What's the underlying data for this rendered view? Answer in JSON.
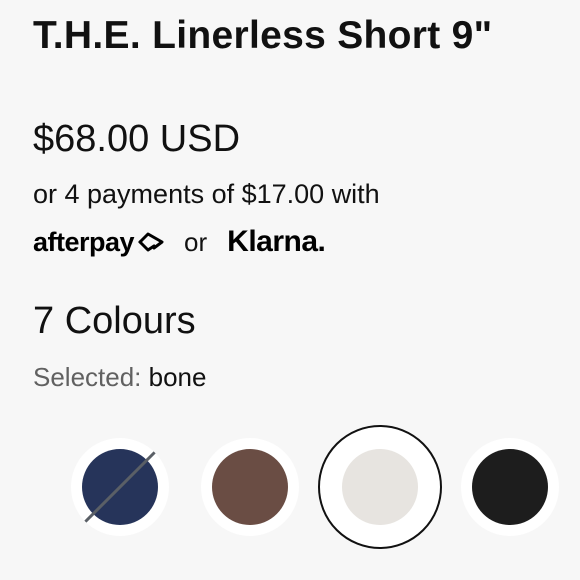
{
  "product": {
    "title": "T.H.E. Linerless Short 9\""
  },
  "pricing": {
    "price": "$68.00 USD",
    "installments_text": "or 4 payments of $17.00 with",
    "afterpay_label": "afterpay",
    "or_text": "or",
    "klarna_label": "Klarna."
  },
  "colours": {
    "count_text": "7 Colours",
    "selected_label": "Selected:",
    "selected_value": "bone",
    "swatches": [
      {
        "name": "navy",
        "color": "#26345a",
        "unavailable": true
      },
      {
        "name": "brown",
        "color": "#6a4d44",
        "unavailable": false
      },
      {
        "name": "bone",
        "color": "#e7e4e0",
        "unavailable": false,
        "selected": true
      },
      {
        "name": "black",
        "color": "#1d1d1d",
        "unavailable": false
      }
    ]
  },
  "theme": {
    "text": "#111111",
    "muted": "#616161",
    "background": "#f7f7f7"
  }
}
